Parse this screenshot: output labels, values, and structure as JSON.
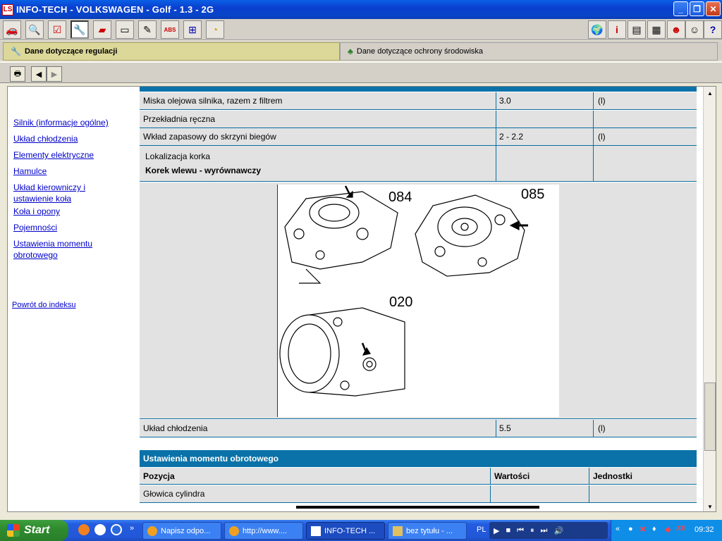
{
  "window": {
    "title": "INFO-TECH - VOLKSWAGEN - Golf - 1.3  - 2G",
    "app_icon": "LS"
  },
  "toolbar": {
    "left_icons": [
      "car-icon",
      "magnifier-icon",
      "checkmark-icon",
      "wrench-icon",
      "oil-can-icon",
      "ruler-icon",
      "pencil-icon",
      "abs-icon",
      "network-icon",
      "clock-icon"
    ],
    "right_icons": [
      "globe-icon",
      "info-icon",
      "notebook-icon",
      "notepad-icon",
      "alert-person-icon",
      "person-icon",
      "help-icon"
    ]
  },
  "tabs": [
    {
      "label": "Dane dotyczące regulacji",
      "icon": "wrench-icon",
      "active": true
    },
    {
      "label": "Dane dotyczące ochrony środowiska",
      "icon": "tree-icon",
      "active": false
    }
  ],
  "sidebar": {
    "links": [
      {
        "label": "Silnik (informacje ogólne)"
      },
      {
        "label": "Układ chłodzenia"
      },
      {
        "label": "Elementy elektryczne"
      },
      {
        "label": "Hamulce"
      },
      {
        "label": "Układ kierowniczy i"
      },
      {
        "label": "ustawienie koła"
      },
      {
        "label": "Koła i opony"
      },
      {
        "label": "Pojemności"
      },
      {
        "label": "Ustawienia momentu "
      },
      {
        "label": "obrotowego"
      }
    ],
    "back_link": "Powrót do indeksu"
  },
  "table1": {
    "rows": [
      {
        "pos": "Miska olejowa silnika, razem z filtrem",
        "value": "3.0",
        "unit": "(l)"
      },
      {
        "pos": "Przekładnia ręczna",
        "value": "",
        "unit": ""
      },
      {
        "pos": "Wkład zapasowy do skrzyni biegów",
        "value": "2 - 2.2",
        "unit": "(l)"
      }
    ],
    "location_label": "Lokalizacja korka",
    "location_value": "Korek wlewu - wyrównawczy",
    "figure_labels": [
      "084",
      "085",
      "020"
    ],
    "cooling": {
      "pos": "Układ chłodzenia",
      "value": "5.5",
      "unit": "(l)"
    }
  },
  "table2": {
    "title": "Ustawienia momentu obrotowego",
    "headers": [
      "Pozycja",
      "Wartości",
      "Jednostki"
    ],
    "rows": [
      {
        "pos": "Głowica cylindra",
        "value": "",
        "unit": ""
      }
    ]
  },
  "taskbar": {
    "start": "Start",
    "tasks": [
      {
        "label": "Napisz odpo...",
        "active": false
      },
      {
        "label": "http://www....",
        "active": false
      },
      {
        "label": "INFO-TECH ...",
        "active": true
      },
      {
        "label": "bez tytułu - ...",
        "active": false
      }
    ],
    "lang": "PL",
    "clock": "09:32"
  },
  "colors": {
    "accent_blue": "#0a72a8",
    "link_blue": "#0000cc",
    "tab_active": "#dcd89a"
  }
}
